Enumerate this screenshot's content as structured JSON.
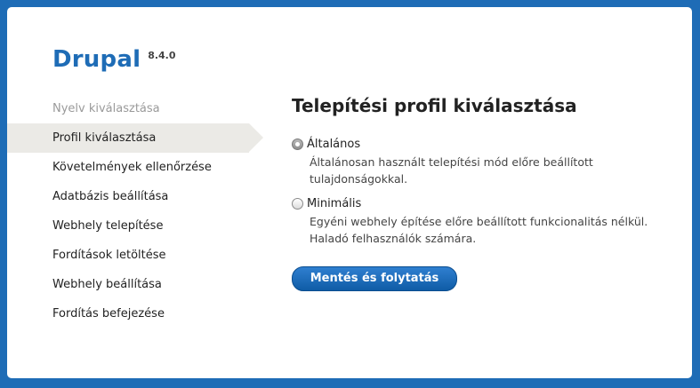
{
  "brand": {
    "name": "Drupal",
    "version": "8.4.0"
  },
  "steps": [
    {
      "label": "Nyelv kiválasztása",
      "state": "done"
    },
    {
      "label": "Profil kiválasztása",
      "state": "active"
    },
    {
      "label": "Követelmények ellenőrzése",
      "state": "pending"
    },
    {
      "label": "Adatbázis beállítása",
      "state": "pending"
    },
    {
      "label": "Webhely telepítése",
      "state": "pending"
    },
    {
      "label": "Fordítások letöltése",
      "state": "pending"
    },
    {
      "label": "Webhely beállítása",
      "state": "pending"
    },
    {
      "label": "Fordítás befejezése",
      "state": "pending"
    }
  ],
  "main": {
    "title": "Telepítési profil kiválasztása",
    "options": [
      {
        "label": "Általános",
        "description_lines": [
          "Általánosan használt telepítési mód előre beállított",
          "tulajdonságokkal."
        ],
        "selected": true
      },
      {
        "label": "Minimális",
        "description_lines": [
          "Egyéni webhely építése előre beállított funkcionalitás nélkül.",
          "Haladó felhasználók számára."
        ],
        "selected": false
      }
    ],
    "submit_label": "Mentés és folytatás"
  },
  "colors": {
    "background": "#1e6cb6",
    "brand": "#1e6cb6",
    "active_step_bg": "#ebeae6",
    "button": "#1b6bbd"
  }
}
